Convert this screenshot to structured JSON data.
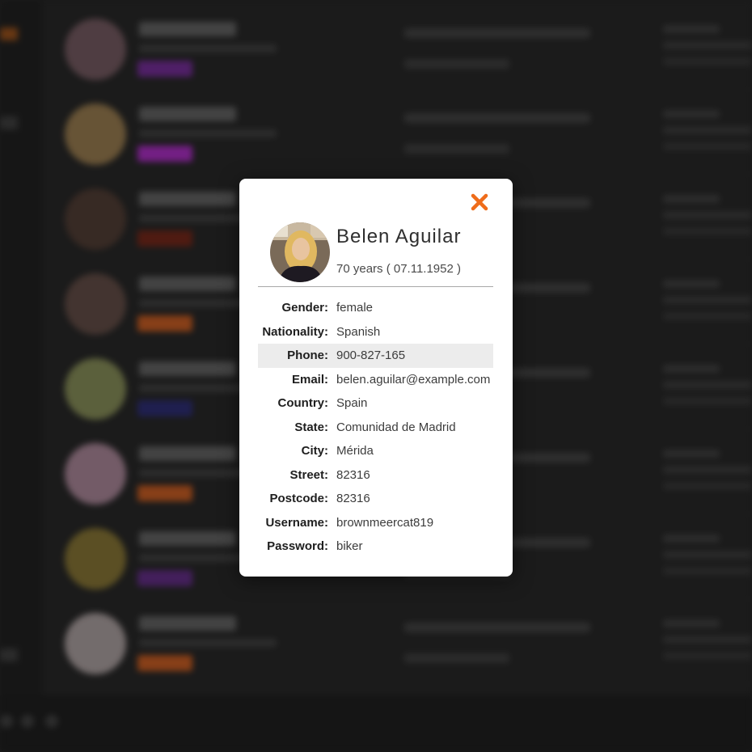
{
  "colors": {
    "accent": "#ef6c1a",
    "background": "#242424",
    "modal_background": "#ffffff",
    "highlight_row": "#ececec",
    "tag_colors": [
      "#6a2a8a",
      "#9a2ab0",
      "#6a2418",
      "#b45420",
      "#2a2a6a",
      "#b45420",
      "#5a2a7a",
      "#b45420"
    ]
  },
  "profile": {
    "name": "Belen Aguilar",
    "age_line": "70 years ( 07.11.1952 )",
    "details": [
      {
        "label": "Gender:",
        "value": "female"
      },
      {
        "label": "Nationality:",
        "value": "Spanish"
      },
      {
        "label": "Phone:",
        "value": "900-827-165",
        "highlighted": true
      },
      {
        "label": "Email:",
        "value": "belen.aguilar@example.com"
      },
      {
        "label": "Country:",
        "value": "Spain"
      },
      {
        "label": "State:",
        "value": "Comunidad de Madrid"
      },
      {
        "label": "City:",
        "value": "Mérida"
      },
      {
        "label": "Street:",
        "value": "82316"
      },
      {
        "label": "Postcode:",
        "value": "82316"
      },
      {
        "label": "Username:",
        "value": "brownmeercat819"
      },
      {
        "label": "Password:",
        "value": "biker"
      }
    ]
  },
  "icons": {
    "close": "close-icon"
  }
}
